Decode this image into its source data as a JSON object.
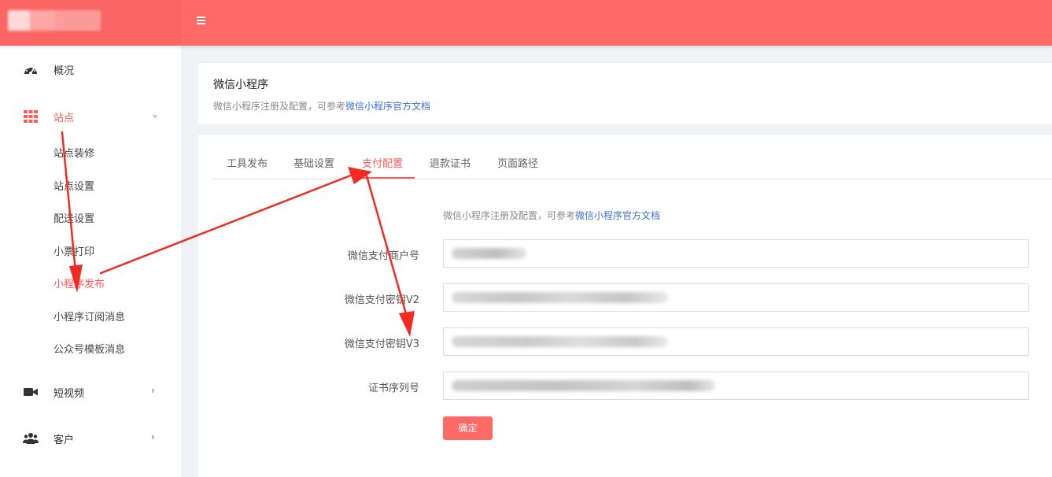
{
  "header": {
    "menu_icon": "hamburger-icon"
  },
  "sidebar": {
    "groups": [
      {
        "label": "概况",
        "icon": "dashboard-icon"
      },
      {
        "label": "站点",
        "icon": "grid-icon",
        "expanded": true
      },
      {
        "label": "短视频",
        "icon": "video-camera-icon"
      },
      {
        "label": "客户",
        "icon": "users-icon"
      }
    ],
    "sub_items": [
      "站点装修",
      "站点设置",
      "配送设置",
      "小票打印",
      "小程序发布",
      "小程序订阅消息",
      "公众号模板消息"
    ],
    "active_sub_item": "小程序发布"
  },
  "page": {
    "title": "微信小程序",
    "desc_prefix": "微信小程序注册及配置，可参考",
    "desc_link": "微信小程序官方文档"
  },
  "tabs": {
    "items": [
      "工具发布",
      "基础设置",
      "支付配置",
      "退款证书",
      "页面路径"
    ],
    "active": "支付配置"
  },
  "form": {
    "hint_prefix": "微信小程序注册及配置，可参考",
    "hint_link": "微信小程序官方文档",
    "fields": [
      {
        "label": "微信支付商户号"
      },
      {
        "label": "微信支付密钥V2"
      },
      {
        "label": "微信支付密钥V3"
      },
      {
        "label": "证书序列号"
      }
    ],
    "submit_label": "确定"
  },
  "colors": {
    "brand": "#ff6a67",
    "active_text": "#ff5a55",
    "link": "#3f6fd8",
    "annotation_arrow": "#f22a22"
  }
}
